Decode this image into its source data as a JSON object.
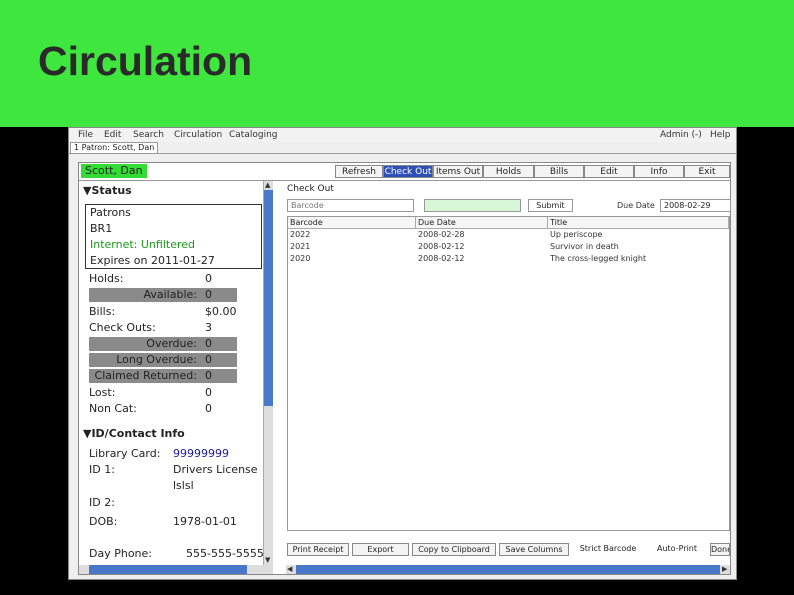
{
  "slide": {
    "title": "Circulation"
  },
  "menubar": {
    "items": [
      "File",
      "Edit",
      "Search",
      "Circulation",
      "Cataloging"
    ],
    "right": [
      "Admin (-)",
      "Help"
    ]
  },
  "tabs": [
    "1 Patron: Scott, Dan"
  ],
  "patron": {
    "name": "Scott, Dan"
  },
  "toolbar": [
    "Refresh",
    "Check Out",
    "Items Out",
    "Holds",
    "Bills",
    "Edit",
    "Info",
    "Exit"
  ],
  "status": {
    "header": "▼Status",
    "box": [
      "Patrons",
      "BR1",
      "Internet: Unfiltered",
      "Expires on 2011-01-27"
    ],
    "rows": [
      {
        "label": "Holds:",
        "value": "0"
      },
      {
        "label": "Available:",
        "value": "0"
      },
      {
        "label": "Bills:",
        "value": "$0.00"
      },
      {
        "label": "Check Outs:",
        "value": "3"
      },
      {
        "label": "Overdue:",
        "value": "0"
      },
      {
        "label": "Long Overdue:",
        "value": "0"
      },
      {
        "label": "Claimed Returned:",
        "value": "0"
      },
      {
        "label": "Lost:",
        "value": "0"
      },
      {
        "label": "Non Cat:",
        "value": "0"
      }
    ]
  },
  "contact": {
    "header": "▼ID/Contact Info",
    "library_card_label": "Library Card:",
    "library_card": "99999999",
    "id1_label": "ID 1:",
    "id1": "Drivers License",
    "id1_extra": "lslsl",
    "id2_label": "ID 2:",
    "dob_label": "DOB:",
    "dob": "1978-01-01",
    "day_phone_label": "Day Phone:",
    "day_phone": "555-555-5555"
  },
  "checkout": {
    "title": "Check Out",
    "select_value": "Barcode",
    "submit": "Submit",
    "due_date_label": "Due Date",
    "due_date": "2008-02-29",
    "columns": [
      "Barcode",
      "Due Date",
      "Title"
    ],
    "rows": [
      [
        "2022",
        "2008-02-28",
        "Up periscope"
      ],
      [
        "2021",
        "2008-02-12",
        "Survivor in death"
      ],
      [
        "2020",
        "2008-02-12",
        "The cross-legged knight"
      ]
    ],
    "buttons": [
      "Print Receipt",
      "Export",
      "Copy to Clipboard",
      "Save Columns",
      "Strict Barcode",
      "Auto-Print",
      "Done"
    ]
  },
  "colors": {
    "header_green": "#3ee63e",
    "patron_green": "#33dd33",
    "accent_blue": "#2f4fb8",
    "internet_green": "#1a9a1a",
    "card_blue": "#1a1aa0"
  }
}
